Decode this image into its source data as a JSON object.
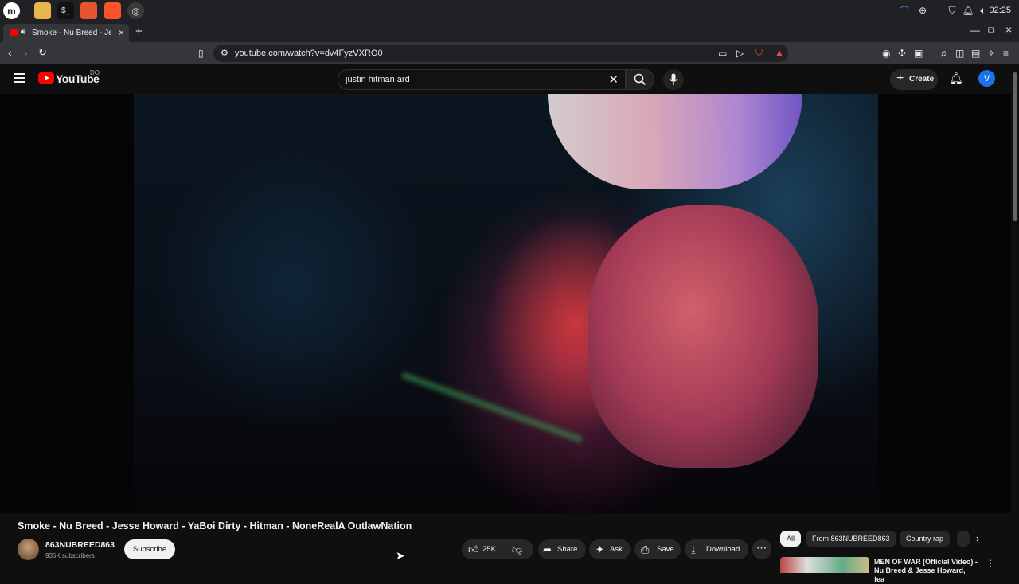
{
  "taskbar": {
    "apps": [
      "mint-menu-icon",
      "files-icon",
      "terminal-icon",
      "firefox-icon",
      "brave-icon",
      "settings-icon"
    ],
    "clock": "02:25"
  },
  "browser": {
    "tab_title": "Smoke - Nu Breed - Jesse Howard",
    "url": "youtube.com/watch?v=dv4FyzVXRO0"
  },
  "youtube": {
    "logo_text": "YouTube",
    "country_code": "DO",
    "search_query": "justin hitman ard",
    "create_label": "Create",
    "avatar_letter": "V"
  },
  "video": {
    "title": "Smoke - Nu Breed - Jesse Howard - YaBoi Dirty - Hitman - NoneRealA OutlawNation",
    "channel": "863NUBREED863",
    "subscribers": "935K subscribers",
    "subscribe_label": "Subscribe",
    "likes": "25K",
    "share_label": "Share",
    "ask_label": "Ask",
    "save_label": "Save",
    "download_label": "Download"
  },
  "chips": [
    "All",
    "From 863NUBREED863",
    "Country rap"
  ],
  "recommendation": {
    "title": "MEN OF WAR (Official Video) - Nu Breed & Jesse Howard, fea"
  }
}
